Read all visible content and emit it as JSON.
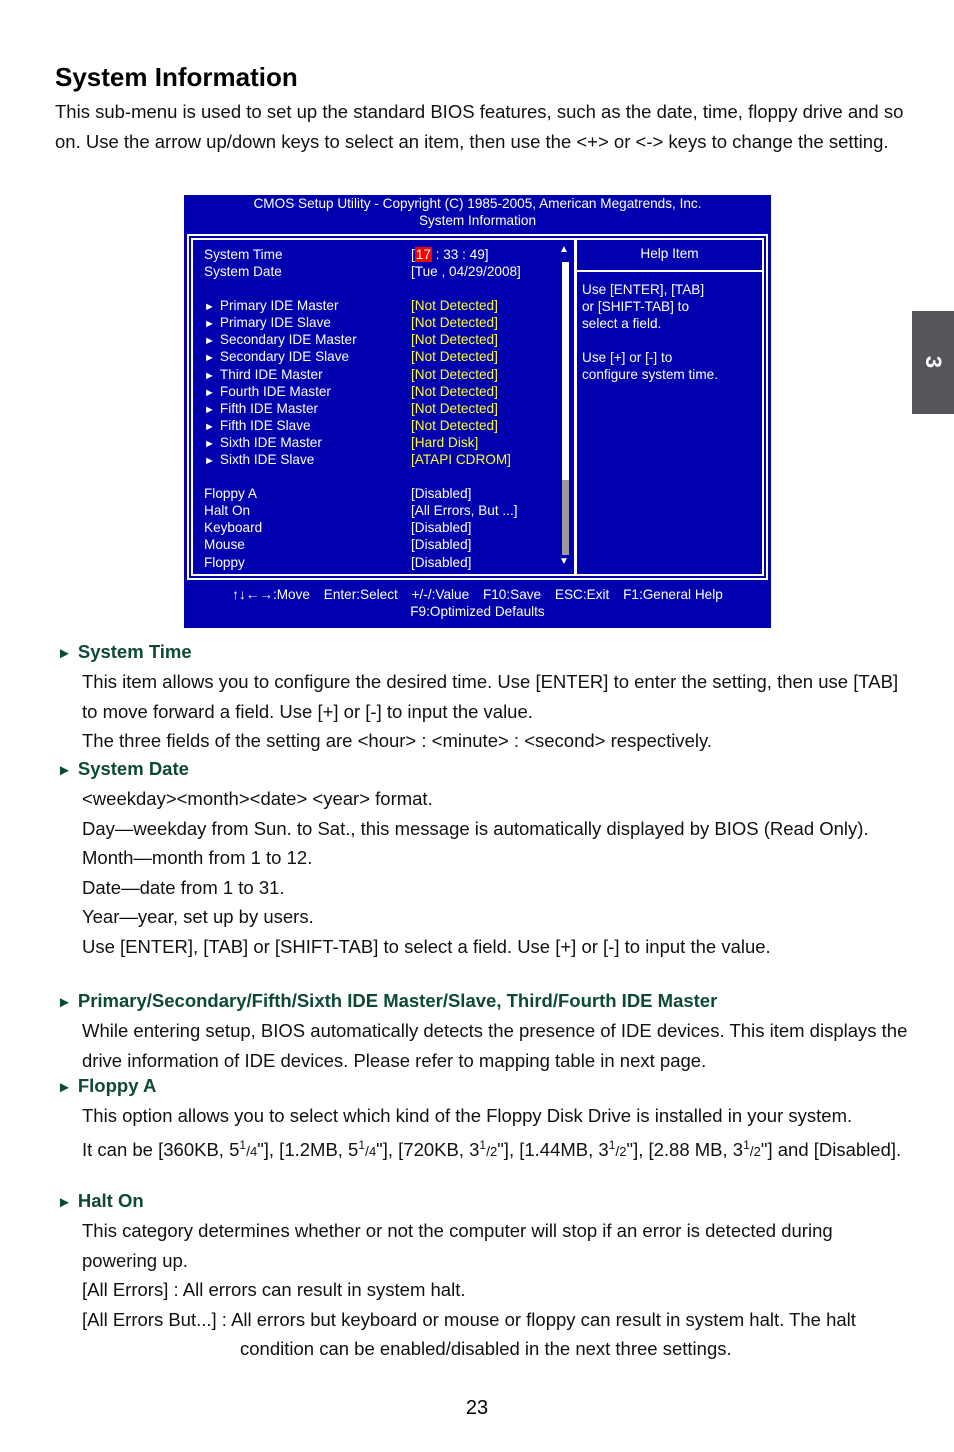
{
  "page": {
    "title": "System Information",
    "intro": "This sub-menu is used to set up the standard BIOS features, such as the date, time, floppy drive and so on. Use the arrow up/down keys to select an item, then use the <+> or <-> keys to change the setting.",
    "chapter_tab": "3",
    "page_number": "23",
    "heading_color": "#0d4a32"
  },
  "bios": {
    "colors": {
      "background": "#0000ae",
      "text": "#ffffff",
      "value_highlight": "#ffff33",
      "cursor": "#ff0000",
      "scroll_thumb": "#9a9a9a"
    },
    "header_line1": "CMOS Setup Utility - Copyright (C) 1985-2005, American Megatrends, Inc.",
    "header_line2": "System Information",
    "system_time": {
      "label": "System Time",
      "open": "[",
      "hour": "17",
      "rest": " : 33 : 49]"
    },
    "system_date": {
      "label": "System Date",
      "value": "[Tue , 04/29/2008]"
    },
    "ide_items": [
      {
        "label": "Primary IDE Master",
        "value": "[Not Detected]"
      },
      {
        "label": "Primary IDE Slave",
        "value": "[Not Detected]"
      },
      {
        "label": "Secondary IDE Master",
        "value": "[Not Detected]"
      },
      {
        "label": "Secondary IDE Slave",
        "value": "[Not Detected]"
      },
      {
        "label": "Third IDE Master",
        "value": "[Not Detected]"
      },
      {
        "label": "Fourth IDE Master",
        "value": "[Not Detected]"
      },
      {
        "label": "Fifth IDE Master",
        "value": "[Not Detected]"
      },
      {
        "label": "Fifth IDE Slave",
        "value": "[Not Detected]"
      },
      {
        "label": "Sixth IDE Master",
        "value": "[Hard Disk]"
      },
      {
        "label": "Sixth IDE Slave",
        "value": "[ATAPI CDROM]"
      }
    ],
    "submenu_arrow": "►",
    "settings": [
      {
        "label": "Floppy A",
        "value": "[Disabled]"
      },
      {
        "label": "Halt On",
        "value": "[All Errors, But ...]"
      },
      {
        "label": "Keyboard",
        "value": "[Disabled]"
      },
      {
        "label": "Mouse",
        "value": "[Disabled]"
      },
      {
        "label": "Floppy",
        "value": "[Disabled]"
      }
    ],
    "scroll_up": "▲",
    "scroll_down": "▼",
    "help": {
      "title": "Help Item",
      "para1_line1": "Use [ENTER], [TAB]",
      "para1_line2": "or [SHIFT-TAB] to",
      "para1_line3": "select a field.",
      "para2_line1": "Use [+] or [-] to",
      "para2_line2": "configure system time."
    },
    "footer": {
      "move": "↑↓←→:Move",
      "select": "Enter:Select",
      "value": "+/-/:Value",
      "save": "F10:Save",
      "exit": "ESC:Exit",
      "help": "F1:General Help",
      "defaults": "F9:Optimized Defaults"
    }
  },
  "sections": {
    "bullet": "►",
    "system_time": {
      "heading": "System Time",
      "lines": [
        "This item allows you to configure the desired time. Use [ENTER] to enter the setting, then use [TAB] to move forward a field. Use [+] or [-] to input the value.",
        "The three fields of the setting are <hour> : <minute> : <second> respectively."
      ]
    },
    "system_date": {
      "heading": "System Date",
      "lines": [
        "<weekday><month><date> <year> format.",
        "Day—weekday from Sun. to Sat., this message is automatically displayed by BIOS (Read Only).",
        "Month—month from 1 to 12.",
        "Date—date from 1 to 31.",
        "Year—year, set up by users.",
        "Use [ENTER], [TAB] or [SHIFT-TAB] to select a field. Use [+] or [-] to input the value."
      ]
    },
    "ide": {
      "heading": "Primary/Secondary/Fifth/Sixth IDE Master/Slave, Third/Fourth IDE Master",
      "lines": [
        "While entering setup, BIOS automatically detects the presence of IDE devices. This item displays the drive information of IDE devices. Please refer to mapping table in next page."
      ]
    },
    "floppy_a": {
      "heading": "Floppy A",
      "line1": "This option allows you to select which kind of the Floppy Disk Drive is installed in your system.",
      "options_prefix": "It can be ",
      "options": [
        "[360KB, 5",
        "1",
        "/",
        "4",
        "\"], [1.2MB, 5",
        "1",
        "/",
        "4",
        "\"], [720KB, 3",
        "1",
        "/",
        "2",
        "\"], [1.44MB, 3",
        "1",
        "/",
        "2",
        "\"], [2.88 MB, 3",
        "1",
        "/",
        "2",
        "\"] and [Disabled]."
      ]
    },
    "halt_on": {
      "heading": "Halt On",
      "lines": [
        "This category determines whether or not the computer will stop if an error is detected during powering up.",
        "[All Errors] : All errors can result in system halt.",
        "[All Errors But...] : All errors but keyboard or mouse or floppy can result in system halt. The halt condition can be enabled/disabled in the next three settings."
      ]
    }
  }
}
